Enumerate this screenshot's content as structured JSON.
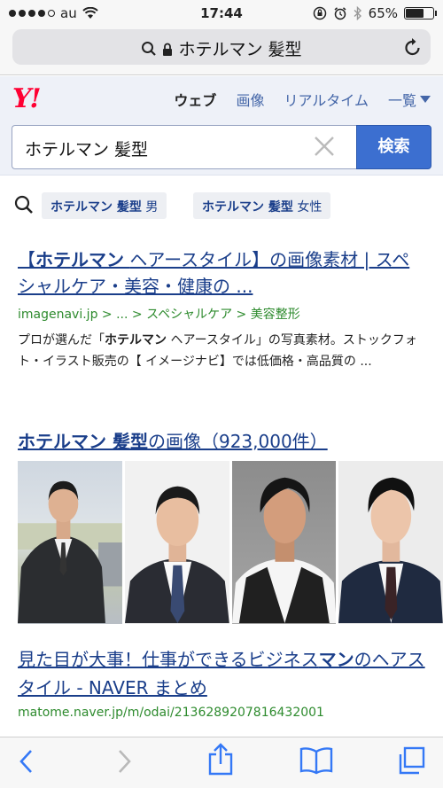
{
  "status_bar": {
    "carrier": "au",
    "time": "17:44",
    "battery": "65%",
    "battery_level": 0.65
  },
  "browser": {
    "url_text": "ホテルマン 髪型"
  },
  "yahoo": {
    "logo": "Y!",
    "nav": {
      "web": "ウェブ",
      "image": "画像",
      "realtime": "リアルタイム",
      "more": "一覧"
    },
    "search_value": "ホテルマン 髪型",
    "search_button": "検索"
  },
  "suggestions": [
    {
      "bold": "ホテルマン 髪型",
      "tail": "男"
    },
    {
      "bold": "ホテルマン 髪型",
      "tail": "女性"
    }
  ],
  "results": {
    "r1": {
      "title_bold": "ホテルマン",
      "title_rest": "ヘアースタイル】の画像素材 | スペシャルケア・美容・健康の ...",
      "title_open": "【",
      "url": "imagenavi.jp > ... > スペシャルケア > 美容整形",
      "snippet_pre": "プロが選んだ「",
      "snippet_bold": "ホテルマン",
      "snippet_post": " ヘアースタイル」の写真素材。ストックフォト・イラスト販売の【 イメージナビ】では低価格・高品質の ..."
    },
    "images": {
      "title_bold": "ホテルマン 髪型",
      "title_rest": "の画像（923,000件）"
    },
    "r3": {
      "title_pre": "見た目が大事！仕事ができるビジネス",
      "title_bold": "マン",
      "title_post": "のヘアスタイル - NAVER まとめ",
      "url": "matome.naver.jp/m/odai/2136289207816432001"
    }
  },
  "icons": [
    "wifi-icon",
    "lock-icon",
    "reload-icon",
    "search-icon",
    "clear-icon",
    "back-icon",
    "forward-icon",
    "share-icon",
    "bookmarks-icon",
    "tabs-icon"
  ],
  "colors": {
    "link": "#1a3e8a",
    "url_green": "#2e8b2e",
    "search_button": "#3c6fd0",
    "yahoo_red": "#ff0033"
  }
}
